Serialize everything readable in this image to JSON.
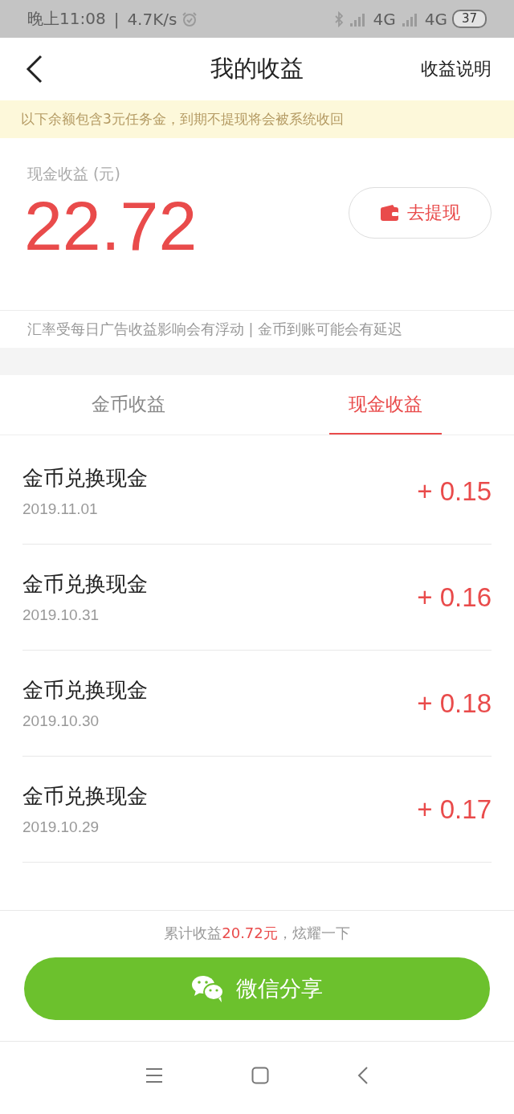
{
  "status_bar": {
    "time": "晚上11:08",
    "separator": "|",
    "speed": "4.7K/s",
    "network_1": "4G",
    "network_2": "4G",
    "battery": "37"
  },
  "header": {
    "title": "我的收益",
    "action": "收益说明"
  },
  "notice": "以下余额包含3元任务金，到期不提现将会被系统收回",
  "balance": {
    "label": "现金收益 (元)",
    "amount": "22.72",
    "withdraw_button": "去提现"
  },
  "hint": "汇率受每日广告收益影响会有浮动 | 金币到账可能会有延迟",
  "tabs": [
    {
      "label": "金币收益",
      "selected": false
    },
    {
      "label": "现金收益",
      "selected": true
    }
  ],
  "records": [
    {
      "title": "金币兑换现金",
      "date": "2019.11.01",
      "amount": "+ 0.15"
    },
    {
      "title": "金币兑换现金",
      "date": "2019.10.31",
      "amount": "+ 0.16"
    },
    {
      "title": "金币兑换现金",
      "date": "2019.10.30",
      "amount": "+ 0.18"
    },
    {
      "title": "金币兑换现金",
      "date": "2019.10.29",
      "amount": "+ 0.17"
    }
  ],
  "footer": {
    "summary": "累计收益**20.72元**，炫耀一下",
    "share_button": "微信分享"
  }
}
